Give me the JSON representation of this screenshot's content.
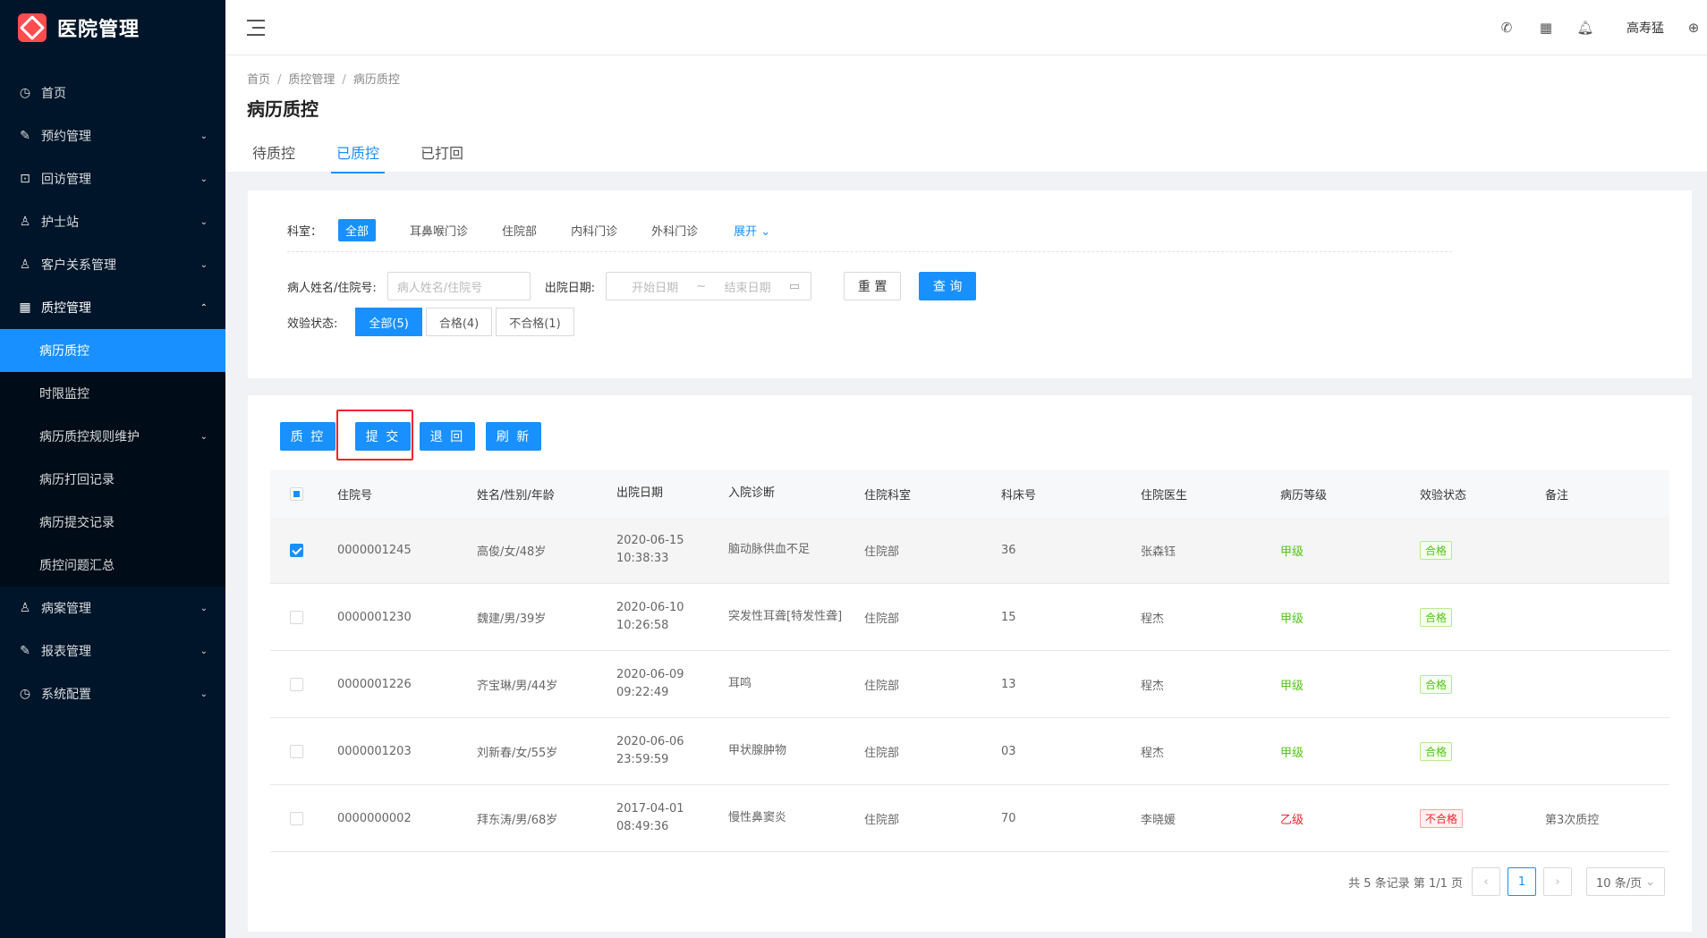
{
  "app": {
    "title": "医院管理"
  },
  "sidebar": {
    "items": [
      {
        "label": "首页",
        "icon": "dashboard-icon",
        "glyph": "◷"
      },
      {
        "label": "预约管理",
        "icon": "edit-icon",
        "glyph": "✎"
      },
      {
        "label": "回访管理",
        "icon": "lock-icon",
        "glyph": "🔒"
      },
      {
        "label": "护士站",
        "icon": "user-icon",
        "glyph": "♙"
      },
      {
        "label": "客户关系管理",
        "icon": "user-icon",
        "glyph": "♙"
      },
      {
        "label": "质控管理",
        "icon": "table-icon",
        "glyph": "▦"
      }
    ],
    "sub_items": [
      {
        "label": "病历质控"
      },
      {
        "label": "时限监控"
      },
      {
        "label": "病历质控规则维护"
      },
      {
        "label": "病历打回记录"
      },
      {
        "label": "病历提交记录"
      },
      {
        "label": "质控问题汇总"
      }
    ],
    "after_items": [
      {
        "label": "病案管理",
        "icon": "user-icon",
        "glyph": "♙"
      },
      {
        "label": "报表管理",
        "icon": "edit-icon",
        "glyph": "✎"
      },
      {
        "label": "系统配置",
        "icon": "dashboard-icon",
        "glyph": "◷"
      }
    ]
  },
  "header": {
    "user_name": "高寿猛",
    "icons": [
      "phone-icon",
      "apps-icon",
      "bell-icon",
      "globe-icon"
    ]
  },
  "breadcrumb": [
    "首页",
    "质控管理",
    "病历质控"
  ],
  "page_title": "病历质控",
  "tabs": [
    "待质控",
    "已质控",
    "已打回"
  ],
  "filters": {
    "dept_label": "科室：",
    "dept_options": [
      "全部",
      "耳鼻喉门诊",
      "住院部",
      "内科门诊",
      "外科门诊"
    ],
    "expand_label": "展开",
    "patient_label": "病人姓名/住院号:",
    "patient_placeholder": "病人姓名/住院号",
    "discharge_label": "出院日期:",
    "start_placeholder": "开始日期",
    "range_sep": "~",
    "end_placeholder": "结束日期",
    "reset_label": "重 置",
    "query_label": "查 询",
    "status_label": "效验状态:",
    "status_options": [
      "全部(5)",
      "合格(4)",
      "不合格(1)"
    ]
  },
  "actions": [
    "质 控",
    "提 交",
    "退 回",
    "刷 新"
  ],
  "table": {
    "columns": [
      "住院号",
      "姓名/性别/年龄",
      "出院日期",
      "入院诊断",
      "住院科室",
      "科床号",
      "住院医生",
      "病历等级",
      "效验状态",
      "备注"
    ],
    "rows": [
      {
        "checked": true,
        "id": "0000001245",
        "name": "高俊/女/48岁",
        "date": "2020-06-15",
        "time": "10:38:33",
        "diag": "脑动脉供血不足",
        "dept": "住院部",
        "bed": "36",
        "doctor": "张森钰",
        "grade": "甲级",
        "status": "合格",
        "note": ""
      },
      {
        "checked": false,
        "id": "0000001230",
        "name": "魏建/男/39岁",
        "date": "2020-06-10",
        "time": "10:26:58",
        "diag": "突发性耳聋[特发性聋]",
        "dept": "住院部",
        "bed": "15",
        "doctor": "程杰",
        "grade": "甲级",
        "status": "合格",
        "note": ""
      },
      {
        "checked": false,
        "id": "0000001226",
        "name": "齐宝琳/男/44岁",
        "date": "2020-06-09",
        "time": "09:22:49",
        "diag": "耳鸣",
        "dept": "住院部",
        "bed": "13",
        "doctor": "程杰",
        "grade": "甲级",
        "status": "合格",
        "note": ""
      },
      {
        "checked": false,
        "id": "0000001203",
        "name": "刘新春/女/55岁",
        "date": "2020-06-06",
        "time": "23:59:59",
        "diag": "甲状腺肿物",
        "dept": "住院部",
        "bed": "03",
        "doctor": "程杰",
        "grade": "甲级",
        "status": "合格",
        "note": ""
      },
      {
        "checked": false,
        "id": "0000000002",
        "name": "拜东涛/男/68岁",
        "date": "2017-04-01",
        "time": "08:49:36",
        "diag": "慢性鼻窦炎",
        "dept": "住院部",
        "bed": "70",
        "doctor": "李晓媛",
        "grade": "乙级",
        "status": "不合格",
        "note": "第3次质控"
      }
    ]
  },
  "pagination": {
    "summary": "共 5 条记录 第 1/1 页",
    "current": "1",
    "page_size": "10 条/页"
  },
  "colors": {
    "primary": "#1890ff",
    "sidebar": "#001529",
    "ok": "#52c41a",
    "bad": "#f5222d"
  }
}
